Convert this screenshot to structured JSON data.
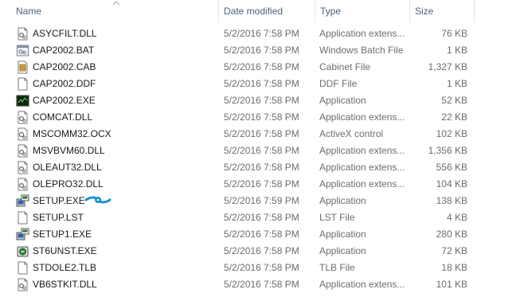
{
  "columns": {
    "name": "Name",
    "date": "Date modified",
    "type": "Type",
    "size": "Size"
  },
  "files": [
    {
      "name": "ASYCFILT.DLL",
      "date": "5/2/2016 7:58 PM",
      "type": "Application extens...",
      "size": "76 KB",
      "icon": "dll-file-icon"
    },
    {
      "name": "CAP2002.BAT",
      "date": "5/2/2016 7:58 PM",
      "type": "Windows Batch File",
      "size": "1 KB",
      "icon": "batch-file-icon"
    },
    {
      "name": "CAP2002.CAB",
      "date": "5/2/2016 7:58 PM",
      "type": "Cabinet File",
      "size": "1,327 KB",
      "icon": "cabinet-file-icon"
    },
    {
      "name": "CAP2002.DDF",
      "date": "5/2/2016 7:58 PM",
      "type": "DDF File",
      "size": "1 KB",
      "icon": "blank-file-icon"
    },
    {
      "name": "CAP2002.EXE",
      "date": "5/2/2016 7:58 PM",
      "type": "Application",
      "size": "52 KB",
      "icon": "exe-app-icon"
    },
    {
      "name": "COMCAT.DLL",
      "date": "5/2/2016 7:58 PM",
      "type": "Application extens...",
      "size": "22 KB",
      "icon": "dll-file-icon"
    },
    {
      "name": "MSCOMM32.OCX",
      "date": "5/2/2016 7:58 PM",
      "type": "ActiveX control",
      "size": "102 KB",
      "icon": "ocx-file-icon"
    },
    {
      "name": "MSVBVM60.DLL",
      "date": "5/2/2016 7:58 PM",
      "type": "Application extens...",
      "size": "1,356 KB",
      "icon": "dll-file-icon"
    },
    {
      "name": "OLEAUT32.DLL",
      "date": "5/2/2016 7:58 PM",
      "type": "Application extens...",
      "size": "556 KB",
      "icon": "dll-file-icon"
    },
    {
      "name": "OLEPRO32.DLL",
      "date": "5/2/2016 7:58 PM",
      "type": "Application extens...",
      "size": "104 KB",
      "icon": "dll-file-icon"
    },
    {
      "name": "SETUP.EXE",
      "date": "5/2/2016 7:59 PM",
      "type": "Application",
      "size": "138 KB",
      "icon": "setup-app-icon"
    },
    {
      "name": "SETUP.LST",
      "date": "5/2/2016 7:58 PM",
      "type": "LST File",
      "size": "4 KB",
      "icon": "blank-file-icon"
    },
    {
      "name": "SETUP1.EXE",
      "date": "5/2/2016 7:58 PM",
      "type": "Application",
      "size": "280 KB",
      "icon": "setup-app-icon"
    },
    {
      "name": "ST6UNST.EXE",
      "date": "5/2/2016 7:58 PM",
      "type": "Application",
      "size": "72 KB",
      "icon": "uninstall-app-icon"
    },
    {
      "name": "STDOLE2.TLB",
      "date": "5/2/2016 7:58 PM",
      "type": "TLB File",
      "size": "18 KB",
      "icon": "blank-file-icon"
    },
    {
      "name": "VB6STKIT.DLL",
      "date": "5/2/2016 7:58 PM",
      "type": "Application extens...",
      "size": "101 KB",
      "icon": "dll-file-icon"
    }
  ],
  "colors": {
    "header_text": "#4c607a",
    "name_text": "#1a1a1a",
    "detail_text": "#6d6d6d",
    "annotation_arrow": "#1a8fd6"
  }
}
